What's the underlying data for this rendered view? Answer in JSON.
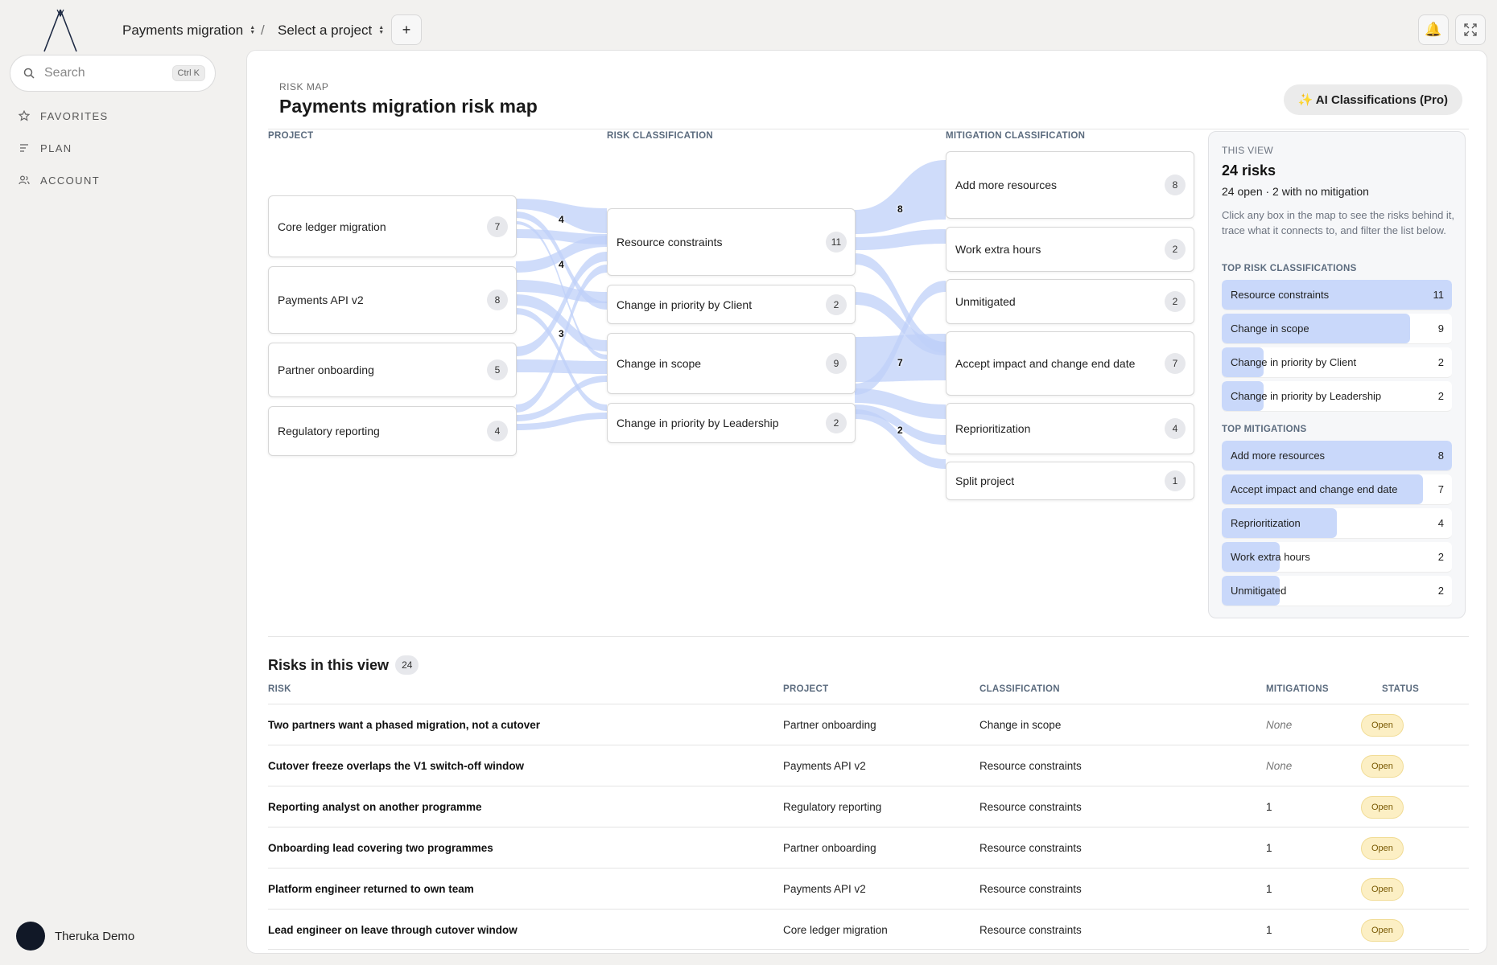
{
  "breadcrumb": {
    "workspace": "Payments migration",
    "separator": "/",
    "project": "Select a project",
    "add_label": "+"
  },
  "topbar_icons": [
    "bell-icon",
    "expand-icon"
  ],
  "search": {
    "placeholder": "Search",
    "shortcut": "Ctrl K"
  },
  "nav": [
    {
      "label": "FAVORITES",
      "icon": "star-icon"
    },
    {
      "label": "PLAN",
      "icon": "list-icon"
    },
    {
      "label": "ACCOUNT",
      "icon": "users-icon"
    }
  ],
  "user": {
    "name": "Theruka Demo"
  },
  "page": {
    "eyebrow": "RISK MAP",
    "title": "Payments migration risk map",
    "ai_button": "✨ AI Classifications (Pro)"
  },
  "map": {
    "columns": [
      "PROJECT",
      "RISK CLASSIFICATION",
      "MITIGATION CLASSIFICATION"
    ],
    "projects": [
      {
        "label": "Core ledger migration",
        "count": "7"
      },
      {
        "label": "Payments API v2",
        "count": "8"
      },
      {
        "label": "Partner onboarding",
        "count": "5"
      },
      {
        "label": "Regulatory reporting",
        "count": "4"
      }
    ],
    "risks": [
      {
        "label": "Resource constraints",
        "count": "11"
      },
      {
        "label": "Change in priority by Client",
        "count": "2"
      },
      {
        "label": "Change in scope",
        "count": "9"
      },
      {
        "label": "Change in priority by Leadership",
        "count": "2"
      }
    ],
    "mitigations": [
      {
        "label": "Add more resources",
        "count": "8"
      },
      {
        "label": "Work extra hours",
        "count": "2"
      },
      {
        "label": "Unmitigated",
        "count": "2"
      },
      {
        "label": "Accept impact and change end date",
        "count": "7"
      },
      {
        "label": "Reprioritization",
        "count": "4"
      },
      {
        "label": "Split project",
        "count": "1"
      }
    ],
    "flow_labels": [
      "4",
      "4",
      "3",
      "8",
      "7",
      "2"
    ]
  },
  "summary": {
    "eyebrow": "THIS VIEW",
    "total": "24 risks",
    "subline": "24 open · 2 with no mitigation",
    "description": "Click any box in the map to see the risks behind it, trace what it connects to, and filter the list below.",
    "top_risks_title": "TOP RISK CLASSIFICATIONS",
    "top_risks": [
      {
        "label": "Resource constraints",
        "value": 11
      },
      {
        "label": "Change in scope",
        "value": 9
      },
      {
        "label": "Change in priority by Client",
        "value": 2
      },
      {
        "label": "Change in priority by Leadership",
        "value": 2
      }
    ],
    "top_mitigations_title": "TOP MITIGATIONS",
    "top_mitigations": [
      {
        "label": "Add more resources",
        "value": 8
      },
      {
        "label": "Accept impact and change end date",
        "value": 7
      },
      {
        "label": "Reprioritization",
        "value": 4
      },
      {
        "label": "Work extra hours",
        "value": 2
      },
      {
        "label": "Unmitigated",
        "value": 2
      }
    ]
  },
  "table": {
    "title": "Risks in this view",
    "count": "24",
    "headers": [
      "RISK",
      "PROJECT",
      "CLASSIFICATION",
      "MITIGATIONS",
      "STATUS"
    ],
    "rows": [
      {
        "risk": "Two partners want a phased migration, not a cutover",
        "project": "Partner onboarding",
        "classification": "Change in scope",
        "mitigations": "None",
        "status": "Open"
      },
      {
        "risk": "Cutover freeze overlaps the V1 switch-off window",
        "project": "Payments API v2",
        "classification": "Resource constraints",
        "mitigations": "None",
        "status": "Open"
      },
      {
        "risk": "Reporting analyst on another programme",
        "project": "Regulatory reporting",
        "classification": "Resource constraints",
        "mitigations": "1",
        "status": "Open"
      },
      {
        "risk": "Onboarding lead covering two programmes",
        "project": "Partner onboarding",
        "classification": "Resource constraints",
        "mitigations": "1",
        "status": "Open"
      },
      {
        "risk": "Platform engineer returned to own team",
        "project": "Payments API v2",
        "classification": "Resource constraints",
        "mitigations": "1",
        "status": "Open"
      },
      {
        "risk": "Lead engineer on leave through cutover window",
        "project": "Core ledger migration",
        "classification": "Resource constraints",
        "mitigations": "1",
        "status": "Open"
      }
    ]
  },
  "colors": {
    "flow": "#bfd0f8",
    "bar_fill": "#c9d8fa",
    "status_open_bg": "#fcefc4",
    "avatar": "#111827"
  }
}
